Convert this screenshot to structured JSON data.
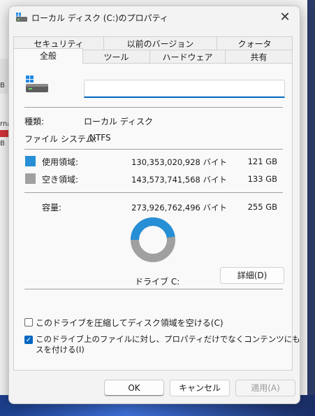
{
  "background": {
    "fragments": [
      "B",
      "rna",
      "B"
    ]
  },
  "window": {
    "title": "ローカル ディスク (C:)のプロパティ",
    "close_glyph": "✕"
  },
  "tabs": {
    "row1": [
      {
        "label": "セキュリティ"
      },
      {
        "label": "以前のバージョン"
      },
      {
        "label": "クォータ"
      }
    ],
    "row2": [
      {
        "label": "全般",
        "active": true
      },
      {
        "label": "ツール"
      },
      {
        "label": "ハードウェア"
      },
      {
        "label": "共有"
      }
    ]
  },
  "general": {
    "name_value": "",
    "type_label": "種類:",
    "type_value": "ローカル ディスク",
    "fs_label": "ファイル システム:",
    "fs_value": "NTFS",
    "used_label": "使用領域:",
    "used_bytes": "130,353,020,928 バイト",
    "used_gb": "121 GB",
    "free_label": "空き領域:",
    "free_bytes": "143,573,741,568 バイト",
    "free_gb": "133 GB",
    "cap_label": "容量:",
    "cap_bytes": "273,926,762,496 バイト",
    "cap_gb": "255 GB",
    "drive_label": "ドライブ C:",
    "details_button": "詳細(D)",
    "used_fraction": 0.4759,
    "colors": {
      "used": "#268fd6",
      "free": "#a0a0a0"
    }
  },
  "options": {
    "compress_label": "このドライブを圧縮してディスク領域を空ける(C)",
    "compress_checked": false,
    "index_label_line1": "このドライブ上のファイルに対し、プロパティだけでなくコンテンツにもインデック",
    "index_label_line2": "スを付ける(I)",
    "index_checked": true,
    "check_glyph": "✓"
  },
  "buttons": {
    "ok": "OK",
    "cancel": "キャンセル",
    "apply": "適用(A)"
  }
}
